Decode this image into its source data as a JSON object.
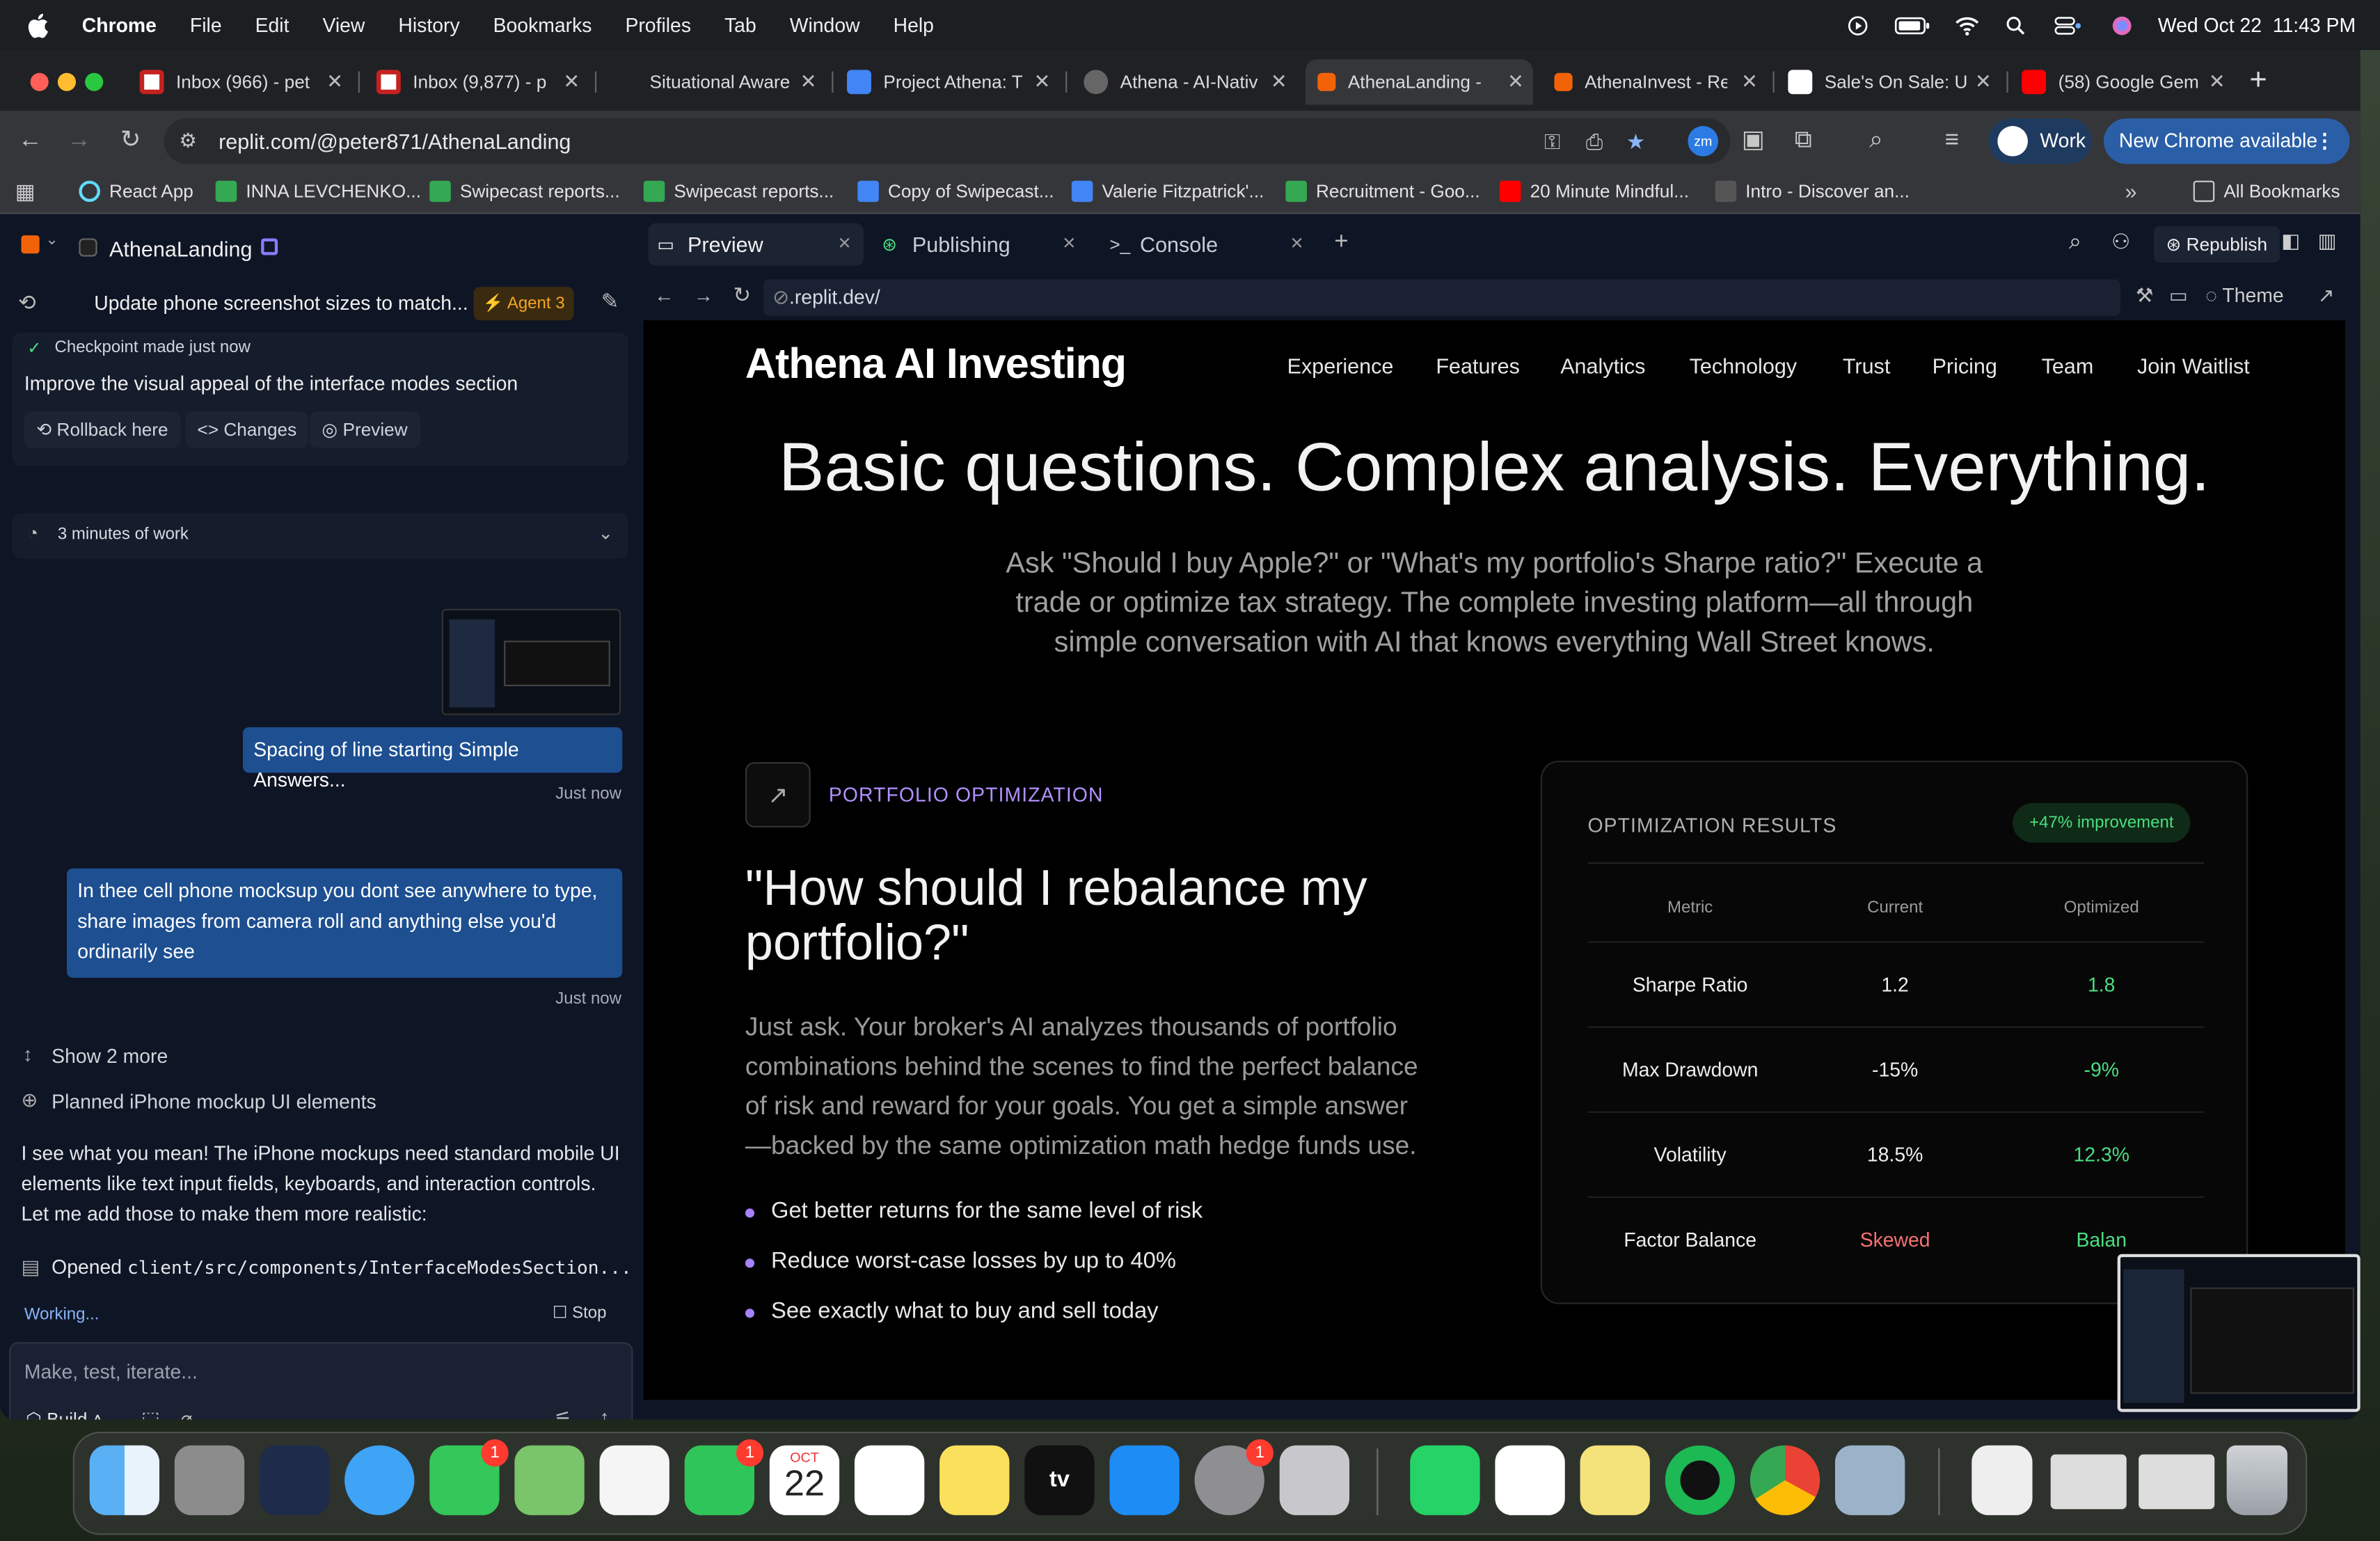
{
  "menubar": {
    "app": "Chrome",
    "items": [
      "File",
      "Edit",
      "View",
      "History",
      "Bookmarks",
      "Profiles",
      "Tab",
      "Window",
      "Help"
    ],
    "datetime": "Wed Oct 22  11:43 PM"
  },
  "tabs": [
    {
      "title": "Inbox (966) - pet",
      "color": "#c5221f"
    },
    {
      "title": "Inbox (9,877) - p",
      "color": "#c5221f"
    },
    {
      "title": "Situational Aware",
      "color": "#333"
    },
    {
      "title": "Project Athena: T",
      "color": "#4285f4"
    },
    {
      "title": "Athena - AI-Nativ",
      "color": "#666"
    },
    {
      "title": "AthenaLanding -",
      "color": "#f26207"
    },
    {
      "title": "AthenaInvest - Re",
      "color": "#f26207"
    },
    {
      "title": "Sale's On Sale: U",
      "color": "#fff"
    },
    {
      "title": "(58) Google Gem",
      "color": "#ff0000"
    }
  ],
  "toolbar": {
    "url": "replit.com/@peter871/AthenaLanding",
    "profile": "Work",
    "new_chrome": "New Chrome available"
  },
  "bookmarks": [
    {
      "label": "React App",
      "color": "#61dafb"
    },
    {
      "label": "INNA LEVCHENKO...",
      "color": "#34a853"
    },
    {
      "label": "Swipecast reports...",
      "color": "#34a853"
    },
    {
      "label": "Swipecast reports...",
      "color": "#34a853"
    },
    {
      "label": "Copy of Swipecast...",
      "color": "#4285f4"
    },
    {
      "label": "Valerie Fitzpatrick'...",
      "color": "#4285f4"
    },
    {
      "label": "Recruitment - Goo...",
      "color": "#34a853"
    },
    {
      "label": "20 Minute Mindful...",
      "color": "#ff0000"
    },
    {
      "label": "Intro - Discover an...",
      "color": "#444"
    }
  ],
  "all_bookmarks": "All Bookmarks",
  "replit": {
    "project": "AthenaLanding",
    "thread_title": "Update phone screenshot sizes to match...",
    "agent_badge": "Agent 3",
    "checkpoint": "Checkpoint made just now",
    "checkpoint_desc": "Improve the visual appeal of the interface modes section",
    "rollback": "Rollback here",
    "changes": "Changes",
    "preview_btn": "Preview",
    "work_time": "3 minutes of work",
    "msg1": "Spacing of line starting Simple Answers...",
    "msg1_time": "Just now",
    "msg2": "In thee cell phone mocksup you dont see anywhere to type, share images from camera roll and anything else you'd ordinarily see",
    "msg2_time": "Just now",
    "show_more": "Show 2 more",
    "planned": "Planned iPhone mockup UI elements",
    "reply": "I see what you mean! The iPhone mockups need standard mobile UI elements like text input fields, keyboards, and interaction controls. Let me add those to make them more realistic:",
    "opened_prefix": "Opened ",
    "opened_path": "client/src/components/InterfaceModesSection...",
    "working": "Working...",
    "stop": "Stop",
    "input_placeholder": "Make, test, iterate...",
    "build": "Build",
    "tabs": [
      "Preview",
      "Publishing",
      "Console"
    ],
    "republish": "Republish",
    "preview_url": ".replit.dev/",
    "theme": "Theme"
  },
  "site": {
    "logo": "Athena AI Investing",
    "nav": [
      "Experience",
      "Features",
      "Analytics",
      "Technology",
      "Trust",
      "Pricing",
      "Team",
      "Join Waitlist"
    ],
    "headline": "Basic questions. Complex analysis. Everything.",
    "sub1": "Ask \"Should I buy Apple?\" or \"What's my portfolio's Sharpe ratio?\" Execute a",
    "sub2": "trade or optimize tax strategy. The complete investing platform—all through",
    "sub3": "simple conversation with AI that knows everything Wall Street knows.",
    "section_label": "PORTFOLIO OPTIMIZATION",
    "question1": "\"How should I rebalance my",
    "question2": "portfolio?\"",
    "body1": "Just ask. Your broker's AI analyzes thousands of portfolio",
    "body2": "combinations behind the scenes to find the perfect balance",
    "body3": "of risk and reward for your goals. You get a simple answer",
    "body4": "—backed by the same optimization math hedge funds use.",
    "bullets": [
      "Get better returns for the same level of risk",
      "Reduce worst-case losses by up to 40%",
      "See exactly what to buy and sell today"
    ],
    "results_title": "OPTIMIZATION RESULTS",
    "improvement": "+47% improvement",
    "table_headers": [
      "Metric",
      "Current",
      "Optimized"
    ],
    "rows": [
      {
        "metric": "Sharpe Ratio",
        "current": "1.2",
        "optimized": "1.8"
      },
      {
        "metric": "Max Drawdown",
        "current": "-15%",
        "optimized": "-9%"
      },
      {
        "metric": "Volatility",
        "current": "18.5%",
        "optimized": "12.3%"
      },
      {
        "metric": "Factor Balance",
        "current": "Skewed",
        "optimized": "Balan"
      }
    ]
  },
  "dock": {
    "calendar_month": "OCT",
    "calendar_day": "22",
    "badges": [
      "1",
      "1",
      "1"
    ]
  }
}
